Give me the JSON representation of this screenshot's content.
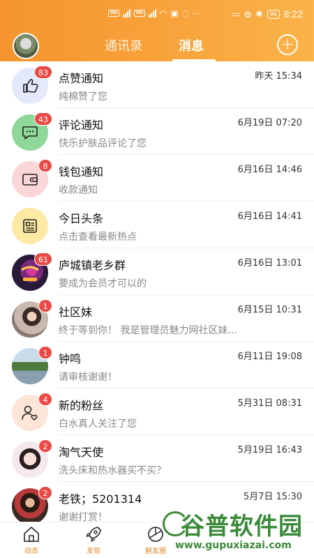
{
  "status_bar": {
    "time": "8:22",
    "battery": "96",
    "hd1": "HD",
    "hd2": "HD"
  },
  "header": {
    "tabs": [
      {
        "label": "通讯录"
      },
      {
        "label": "消息"
      }
    ],
    "add_symbol": "+"
  },
  "messages": [
    {
      "title": "点赞通知",
      "subtitle": "纯棉赞了您",
      "time": "昨天 15:34",
      "badge": "83",
      "icon": "thumbs-up-icon",
      "color": "#e3e8fb"
    },
    {
      "title": "评论通知",
      "subtitle": "快乐护肤品评论了您",
      "time": "6月19日 07:20",
      "badge": "43",
      "icon": "comment-icon",
      "color": "#8fd89a"
    },
    {
      "title": "钱包通知",
      "subtitle": "收款通知",
      "time": "6月16日 14:46",
      "badge": "8",
      "icon": "wallet-icon",
      "color": "#fbd6d8"
    },
    {
      "title": "今日头条",
      "subtitle": "点击查看最新热点",
      "time": "6月16日 14:41",
      "badge": "",
      "icon": "news-icon",
      "color": "#fce9a3"
    },
    {
      "title": "庐城镇老乡群",
      "subtitle": "要成为会员才可以的",
      "time": "6月16日 13:01",
      "badge": "61",
      "icon": "group-avatar",
      "color": "#2a1a3a"
    },
    {
      "title": "社区妹",
      "subtitle": "终于等到你！ 我是管理员魅力网社区妹...",
      "time": "6月15日 10:31",
      "badge": "1",
      "icon": "user-avatar",
      "color": "#b9aaa0"
    },
    {
      "title": "钟鸣",
      "subtitle": "请审核谢谢！",
      "time": "6月11日 19:08",
      "badge": "1",
      "icon": "user-avatar",
      "color": "#8fb0c8"
    },
    {
      "title": "新的粉丝",
      "subtitle": "白水真人关注了您",
      "time": "5月31日 08:31",
      "badge": "4",
      "icon": "new-fan-icon",
      "color": "#fde5d8"
    },
    {
      "title": "淘气天使",
      "subtitle": "洗头床和热水器买不买？",
      "time": "5月19日 16:43",
      "badge": "2",
      "icon": "user-avatar",
      "color": "#f0d8d0"
    },
    {
      "title": "老铁；5201314",
      "subtitle": "谢谢打赏！",
      "time": "5月7日 15:30",
      "badge": "2",
      "icon": "user-avatar",
      "color": "#6a4a40"
    }
  ],
  "bottom_nav": [
    {
      "label": "动态",
      "icon": "home-icon"
    },
    {
      "label": "发现",
      "icon": "rocket-icon"
    },
    {
      "label": "魅友圈",
      "icon": "moments-icon"
    }
  ],
  "watermark": {
    "title": "谷普软件园",
    "url": "www.gupuxiazai.com"
  },
  "colors": {
    "accent": "#f5942e",
    "badge": "#e94a46",
    "nav_label": "#e08a2c"
  }
}
